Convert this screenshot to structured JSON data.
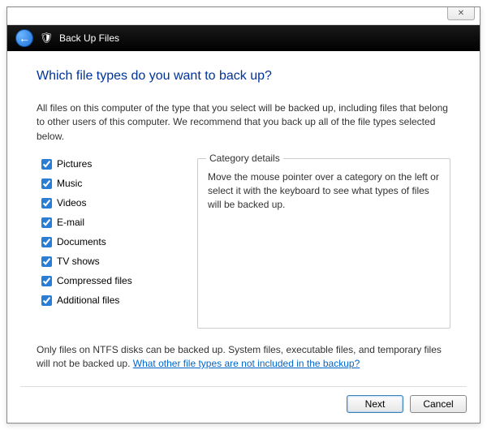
{
  "window": {
    "close_glyph": "✕"
  },
  "header": {
    "back_glyph": "←",
    "shield_glyph": "🛡",
    "title": "Back Up Files"
  },
  "heading": "Which file types do you want to back up?",
  "intro": "All files on this computer of the type that you select will be backed up, including files that belong to other users of this computer. We recommend that you back up all of the file types selected below.",
  "categories": [
    {
      "label": "Pictures",
      "checked": true
    },
    {
      "label": "Music",
      "checked": true
    },
    {
      "label": "Videos",
      "checked": true
    },
    {
      "label": "E-mail",
      "checked": true
    },
    {
      "label": "Documents",
      "checked": true
    },
    {
      "label": "TV shows",
      "checked": true
    },
    {
      "label": "Compressed files",
      "checked": true
    },
    {
      "label": "Additional files",
      "checked": true
    }
  ],
  "details": {
    "legend": "Category details",
    "text": "Move the mouse pointer over a category on the left or select it with the keyboard to see what types of files will be backed up."
  },
  "footer_note_pre": "Only files on NTFS disks can be backed up. System files, executable files, and temporary files will not be backed up. ",
  "footer_link": "What other file types are not included in the backup?",
  "buttons": {
    "next": "Next",
    "cancel": "Cancel"
  }
}
